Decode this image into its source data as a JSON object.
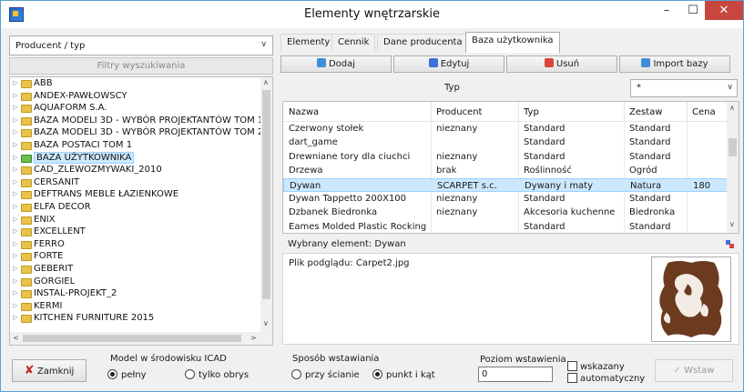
{
  "window": {
    "title": "Elementy wnętrzarskie",
    "controls": {
      "minimize": "–",
      "maximize": "☐",
      "close": "✕"
    }
  },
  "left": {
    "producer_select": {
      "value": "Producent / typ"
    },
    "filters_button": "Filtry wyszukiwania",
    "tree_items": [
      "ABB",
      "ANDEX-PAWŁOWSCY",
      "AQUAFORM S.A.",
      "BAZA MODELI 3D - WYBÓR PROJEKTANTÓW TOM 1",
      "BAZA MODELI 3D - WYBÓR PROJEKTANTÓW TOM 2",
      "BAZA POSTACI TOM 1",
      "BAZA UŻYTKOWNIKA",
      "CAD_ZLEWOZMYWAKI_2010",
      "CERSANIT",
      "DEFTRANS MEBLE ŁAZIENKOWE",
      "ELFA DECOR",
      "ENIX",
      "EXCELLENT",
      "FERRO",
      "FORTE",
      "GEBERIT",
      "GORGIEL",
      "INSTAL-PROJEKT_2",
      "KERMI",
      "KITCHEN FURNITURE 2015"
    ],
    "selected_tree_index": 6
  },
  "tabs": [
    {
      "label": "Elementy"
    },
    {
      "label": "Cennik"
    },
    {
      "label": "Dane producenta"
    },
    {
      "label": "Baza użytkownika"
    }
  ],
  "toolbar": {
    "add": "Dodaj",
    "edit": "Edytuj",
    "remove": "Usuń",
    "import": "Import bazy"
  },
  "type_filter": {
    "label": "Typ",
    "value": "*"
  },
  "table": {
    "columns": [
      "Nazwa",
      "Producent",
      "Typ",
      "Zestaw",
      "Cena"
    ],
    "rows": [
      [
        "Czerwony stołek",
        "nieznany",
        "Standard",
        "Standard",
        ""
      ],
      [
        "dart_game",
        "",
        "Standard",
        "Standard",
        ""
      ],
      [
        "Drewniane tory dla ciuchci",
        "nieznany",
        "Standard",
        "Standard",
        ""
      ],
      [
        "Drzewa",
        "brak",
        "Roślinność",
        "Ogród",
        ""
      ],
      [
        "Dywan",
        "SCARPET s.c.",
        "Dywany i maty",
        "Natura",
        "180"
      ],
      [
        "Dywan Tappetto 200X100",
        "nieznany",
        "Standard",
        "Standard",
        ""
      ],
      [
        "Dzbanek Biedronka",
        "nieznany",
        "Akcesoria kuchenne",
        "Biedronka",
        ""
      ],
      [
        "Eames Molded Plastic Rocking C...",
        "",
        "Standard",
        "Standard",
        ""
      ]
    ],
    "selected_row_index": 4
  },
  "selected_element": {
    "label": "Wybrany element: Dywan"
  },
  "preview": {
    "file_label": "Plik podglądu: Carpet2.jpg"
  },
  "bottom": {
    "close_button": "Zamknij",
    "model_group": {
      "title": "Model w środowisku ICAD",
      "options": [
        "pełny",
        "tylko obrys"
      ],
      "selected": 0
    },
    "insert_group": {
      "title": "Sposób wstawiania",
      "options": [
        "przy ścianie",
        "punkt i kąt"
      ],
      "selected": 1
    },
    "level_group": {
      "title": "Poziom wstawienia",
      "value": "0",
      "checkbox_1": "wskazany",
      "checkbox_2": "automatyczny"
    },
    "insert_button": "Wstaw"
  },
  "colors": {
    "selection_bg": "#cce8ff",
    "selection_border": "#99d1ff",
    "close_btn": "#c7463f",
    "folder": "#e8c24a"
  }
}
